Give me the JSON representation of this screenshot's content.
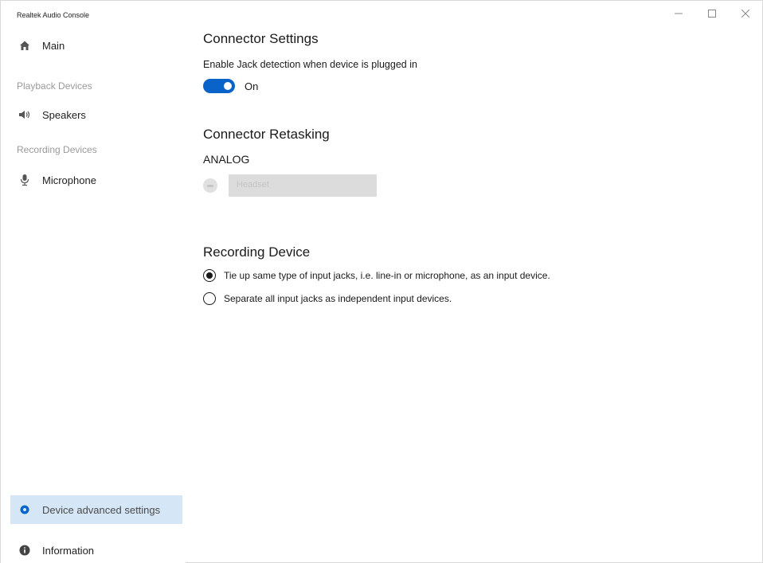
{
  "window": {
    "title": "Realtek Audio Console",
    "controls": {
      "minimize": "minimize-icon",
      "maximize": "maximize-icon",
      "close": "close-icon"
    }
  },
  "sidebar": {
    "main_label": "Main",
    "playback_section": "Playback Devices",
    "speakers_label": "Speakers",
    "recording_section": "Recording Devices",
    "microphone_label": "Microphone",
    "advanced_label": "Device advanced settings",
    "information_label": "Information",
    "active_item": "Device advanced settings"
  },
  "connector_settings": {
    "heading": "Connector Settings",
    "description": "Enable Jack detection when device is plugged in",
    "toggle_state": "On"
  },
  "connector_retasking": {
    "heading": "Connector Retasking",
    "subheading": "ANALOG",
    "select_value": "Headset"
  },
  "recording_device": {
    "heading": "Recording Device",
    "options": [
      {
        "label": "Tie up same type of input jacks, i.e. line-in or microphone, as an input device.",
        "checked": true
      },
      {
        "label": "Separate all input jacks as independent input devices.",
        "checked": false
      }
    ]
  },
  "colors": {
    "accent": "#0a63c9",
    "active_nav_bg": "#d5e6f6",
    "section_label": "#9a9a9a"
  }
}
